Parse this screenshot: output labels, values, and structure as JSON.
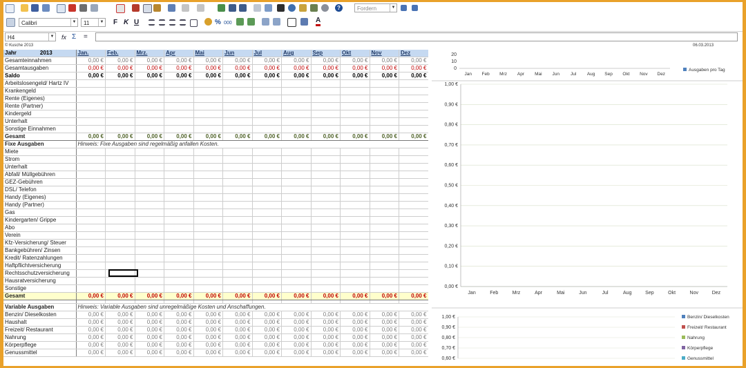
{
  "toolbar": {
    "zoom_value": "Fordern",
    "font_name": "Calibri",
    "font_size": "11",
    "bold": "F",
    "italic": "K",
    "underline": "U",
    "percent": "%",
    "thousands": "000",
    "text_color": "A",
    "help": "?"
  },
  "formula_bar": {
    "name_box": "H4",
    "fx": "fx",
    "equals": "=",
    "value": ""
  },
  "sheet": {
    "copyright": "© Kusche 2013",
    "date": "06.03.2013",
    "year_label": "Jahr",
    "year_value": "2013",
    "months": [
      "Jan.",
      "Feb.",
      "Mrz.",
      "Apr",
      "Mai",
      "Jun",
      "Jul",
      "Aug",
      "Sep",
      "Okt",
      "Nov",
      "Dez"
    ],
    "zero": "0,00 €",
    "summary_rows": [
      "Gesamteinnahmen",
      "Gesamtausgaben",
      "Saldo"
    ],
    "income_rows": [
      "Arbeitslosengeld/ Hartz IV",
      "Krankengeld",
      "Rente (Eigenes)",
      "Rente (Partner)",
      "Kindergeld",
      "Unterhalt",
      "Sonstige Einnahmen"
    ],
    "income_total": "Gesamt",
    "fixed_title": "Fixe Ausgaben",
    "fixed_hint": "Hinweis: Fixe Ausgaben sind regelmäßig anfallen Kosten.",
    "fixed_rows": [
      "Miete",
      "Strom",
      "Unterhalt",
      "Abfall/ Müllgebühren",
      "GEZ-Gebühren",
      "DSL/ Telefon",
      "Handy (Eigenes)",
      "Handy (Partner)",
      "Gas",
      "Kindergarten/ Grippe",
      "Abo",
      "Verein",
      "Kfz-Versicherung/ Steuer",
      "Bankgebühren/ Zinsen",
      "Kredit/ Ratenzahlungen",
      "Haftpflichtversicherung",
      "Rechtsschutzversicherung",
      "Hausratversicherung",
      "Sonstige"
    ],
    "fixed_total": "Gesamt",
    "var_title": "Variable Ausgaben",
    "var_hint": "Hinweis: Variable Ausgaben sind unregelmäßige Kosten und Anschaffungen.",
    "var_rows": [
      "Benzin/ Dieselkosten",
      "Haushalt",
      "Freizeit/ Restaurant",
      "Nahrung",
      "Körperpflege",
      "Genussmittel"
    ]
  },
  "chart_data": [
    {
      "type": "bar",
      "categories": [
        "Jan",
        "Feb",
        "Mrz",
        "Apr",
        "Mai",
        "Jun",
        "Jul",
        "Aug",
        "Sep",
        "Okt",
        "Nov",
        "Dez"
      ],
      "series": [
        {
          "name": "Ausgaben pro Tag",
          "values": [
            0,
            0,
            0,
            0,
            0,
            0,
            0,
            0,
            0,
            0,
            0,
            0
          ]
        }
      ],
      "yticks": [
        "20",
        "10",
        "0"
      ],
      "ylim": [
        0,
        20
      ],
      "legend": "right",
      "color": "#4f81bd"
    },
    {
      "type": "line",
      "categories": [
        "Jan",
        "Feb",
        "Mrz",
        "Apr",
        "Mai",
        "Jun",
        "Jul",
        "Aug",
        "Sep",
        "Okt",
        "Nov",
        "Dez"
      ],
      "series": [],
      "yticks": [
        "1,00 €",
        "0,90 €",
        "0,80 €",
        "0,70 €",
        "0,60 €",
        "0,50 €",
        "0,40 €",
        "0,30 €",
        "0,20 €",
        "0,10 €",
        "0,00 €"
      ],
      "ylim": [
        0,
        1
      ],
      "grid": true
    },
    {
      "type": "bar",
      "categories": [],
      "series": [
        {
          "name": "Benzin/ Dieselkosten",
          "color": "#4f81bd"
        },
        {
          "name": "Freizeit/ Restaurant",
          "color": "#c0504d"
        },
        {
          "name": "Nahrung",
          "color": "#9bbb59"
        },
        {
          "name": "Körperpflege",
          "color": "#8064a2"
        },
        {
          "name": "Genussmittel",
          "color": "#4bacc6"
        }
      ],
      "yticks": [
        "1,00 €",
        "0,90 €",
        "0,80 €",
        "0,70 €",
        "0,60 €"
      ],
      "ylim": [
        0.6,
        1
      ],
      "legend": "right"
    }
  ]
}
